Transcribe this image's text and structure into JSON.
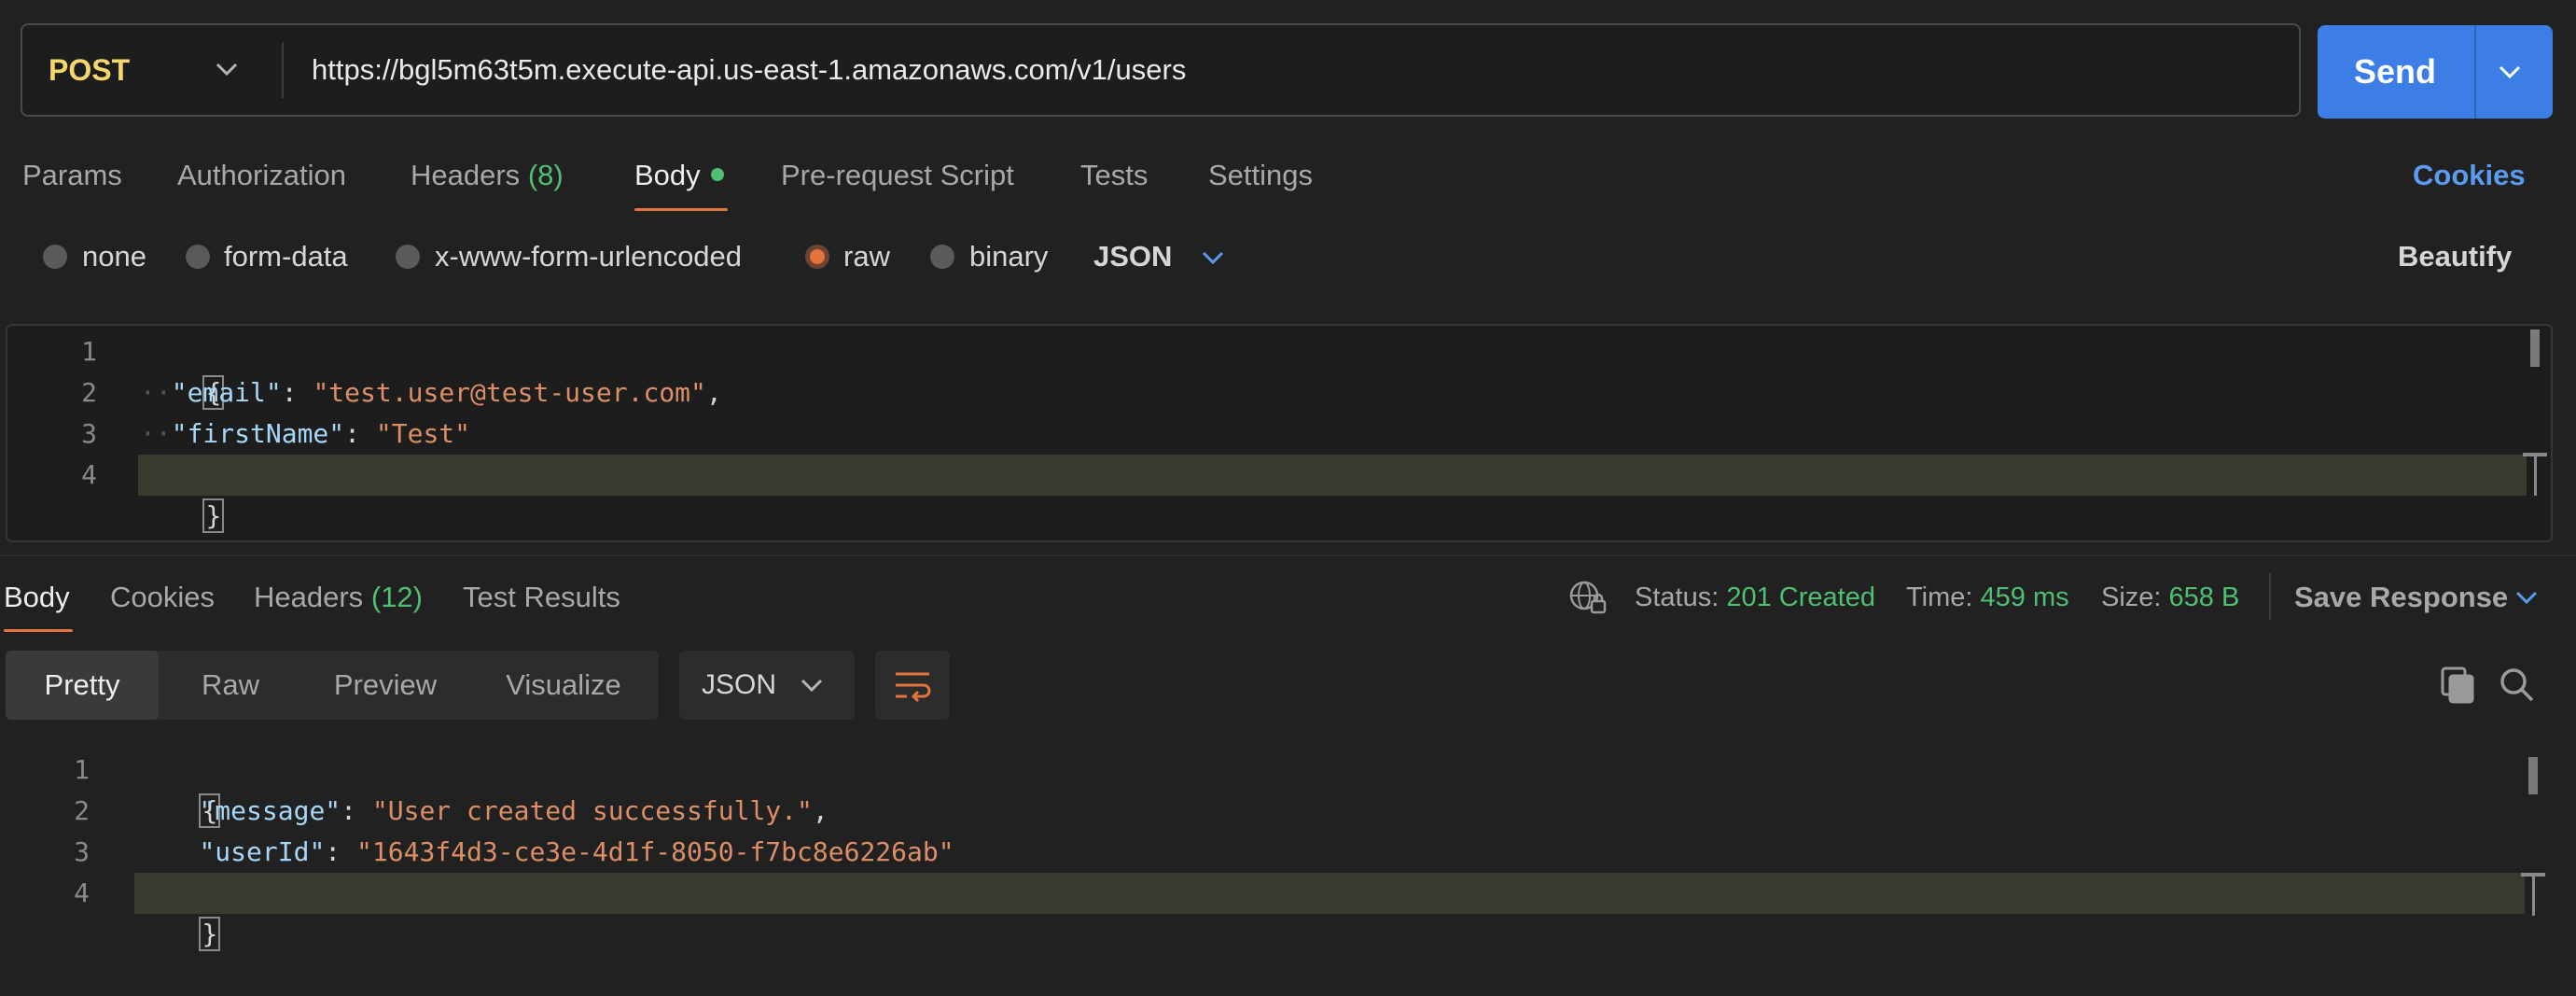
{
  "request": {
    "method": "POST",
    "url": "https://bgl5m63t5m.execute-api.us-east-1.amazonaws.com/v1/users",
    "send_label": "Send"
  },
  "tabs": {
    "params": "Params",
    "authorization": "Authorization",
    "headers": "Headers",
    "headers_count": "(8)",
    "body": "Body",
    "prerequest": "Pre-request Script",
    "tests": "Tests",
    "settings": "Settings",
    "cookies": "Cookies"
  },
  "body_types": {
    "none": "none",
    "form_data": "form-data",
    "urlencoded": "x-www-form-urlencoded",
    "raw": "raw",
    "binary": "binary",
    "format": "JSON",
    "beautify": "Beautify",
    "selected": "raw"
  },
  "request_body": {
    "line_numbers": [
      "1",
      "2",
      "3",
      "4"
    ],
    "open_brace": "{",
    "close_brace": "}",
    "email_key": "\"email\"",
    "email_value": "\"test.user@test-user.com\"",
    "first_name_key": "\"firstName\"",
    "first_name_value": "\"Test\""
  },
  "response": {
    "tabs": {
      "body": "Body",
      "cookies": "Cookies",
      "headers": "Headers",
      "headers_count": "(12)",
      "test_results": "Test Results"
    },
    "status_label": "Status:",
    "status_value": "201 Created",
    "time_label": "Time:",
    "time_value": "459 ms",
    "size_label": "Size:",
    "size_value": "658 B",
    "save_response": "Save Response",
    "views": {
      "pretty": "Pretty",
      "raw": "Raw",
      "preview": "Preview",
      "visualize": "Visualize"
    },
    "format": "JSON",
    "body": {
      "line_numbers": [
        "1",
        "2",
        "3",
        "4"
      ],
      "open_brace": "{",
      "close_brace": "}",
      "message_key": "\"message\"",
      "message_value": "\"User created successfully.\"",
      "user_id_key": "\"userId\"",
      "user_id_value": "\"1643f4d3-ce3e-4d1f-8050-f7bc8e6226ab\""
    }
  },
  "colors": {
    "accent_orange": "#e4743f",
    "send_blue": "#3d7ee6",
    "link_blue": "#5a9bf0",
    "success_green": "#4fbf72",
    "method_yellow": "#f5d76e",
    "json_key": "#a6d7f7",
    "json_string": "#dc8f66"
  },
  "icons": {
    "method_dropdown": "chevron-down-icon",
    "send_dropdown": "chevron-down-icon",
    "format_dropdown": "chevron-down-icon",
    "network": "globe-lock-icon",
    "wrap": "wrap-lines-icon",
    "copy": "copy-icon",
    "search": "search-icon"
  }
}
